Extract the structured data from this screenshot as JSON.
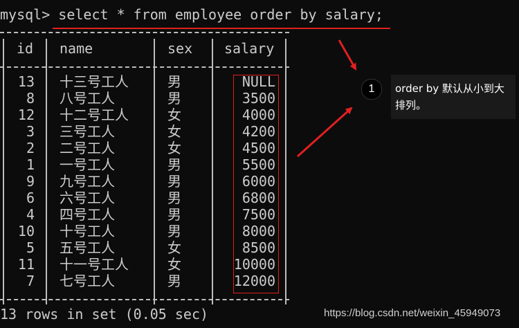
{
  "terminal": {
    "prompt": "mysql>",
    "command": " select * from employee order by salary;",
    "border_line": "+----+------------+------+--------+",
    "columns": [
      "id",
      "name",
      "sex",
      "salary"
    ],
    "rows": [
      {
        "id": "13",
        "name": "十三号工人",
        "sex": "男",
        "salary": "NULL"
      },
      {
        "id": "8",
        "name": "八号工人",
        "sex": "男",
        "salary": "3500"
      },
      {
        "id": "12",
        "name": "十二号工人",
        "sex": "女",
        "salary": "4000"
      },
      {
        "id": "3",
        "name": "三号工人",
        "sex": "女",
        "salary": "4200"
      },
      {
        "id": "2",
        "name": "二号工人",
        "sex": "女",
        "salary": "4500"
      },
      {
        "id": "1",
        "name": "一号工人",
        "sex": "男",
        "salary": "5500"
      },
      {
        "id": "9",
        "name": "九号工人",
        "sex": "男",
        "salary": "6000"
      },
      {
        "id": "6",
        "name": "六号工人",
        "sex": "男",
        "salary": "6800"
      },
      {
        "id": "4",
        "name": "四号工人",
        "sex": "男",
        "salary": "7500"
      },
      {
        "id": "10",
        "name": "十号工人",
        "sex": "男",
        "salary": "8000"
      },
      {
        "id": "5",
        "name": "五号工人",
        "sex": "女",
        "salary": "8500"
      },
      {
        "id": "11",
        "name": "十一号工人",
        "sex": "女",
        "salary": "10000"
      },
      {
        "id": "7",
        "name": "七号工人",
        "sex": "男",
        "salary": "12000"
      }
    ],
    "status": "13 rows in set (0.05 sec)"
  },
  "annotation": {
    "badge": "1",
    "note": "order by 默认从小到大排列。"
  },
  "watermark": "https://blog.csdn.net/weixin_45949073",
  "colors": {
    "background": "#0c0c0c",
    "text": "#cccccc",
    "highlight": "#e02020"
  }
}
